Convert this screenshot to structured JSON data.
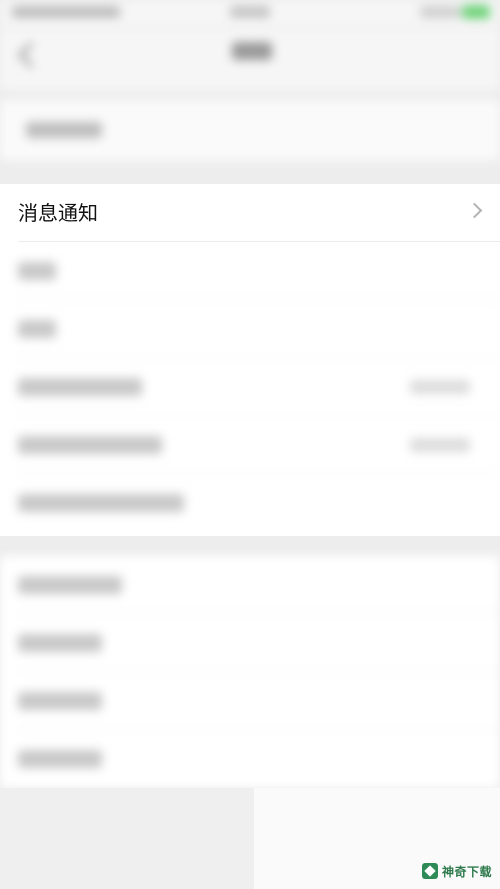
{
  "main_list": {
    "focused_item": {
      "label": "消息通知",
      "icon": "chevron-right-icon"
    }
  },
  "watermark": {
    "text": "神奇下载",
    "color": "#2e7a4d"
  },
  "colors": {
    "accent_green": "#6fd37a",
    "background": "#ededed"
  }
}
